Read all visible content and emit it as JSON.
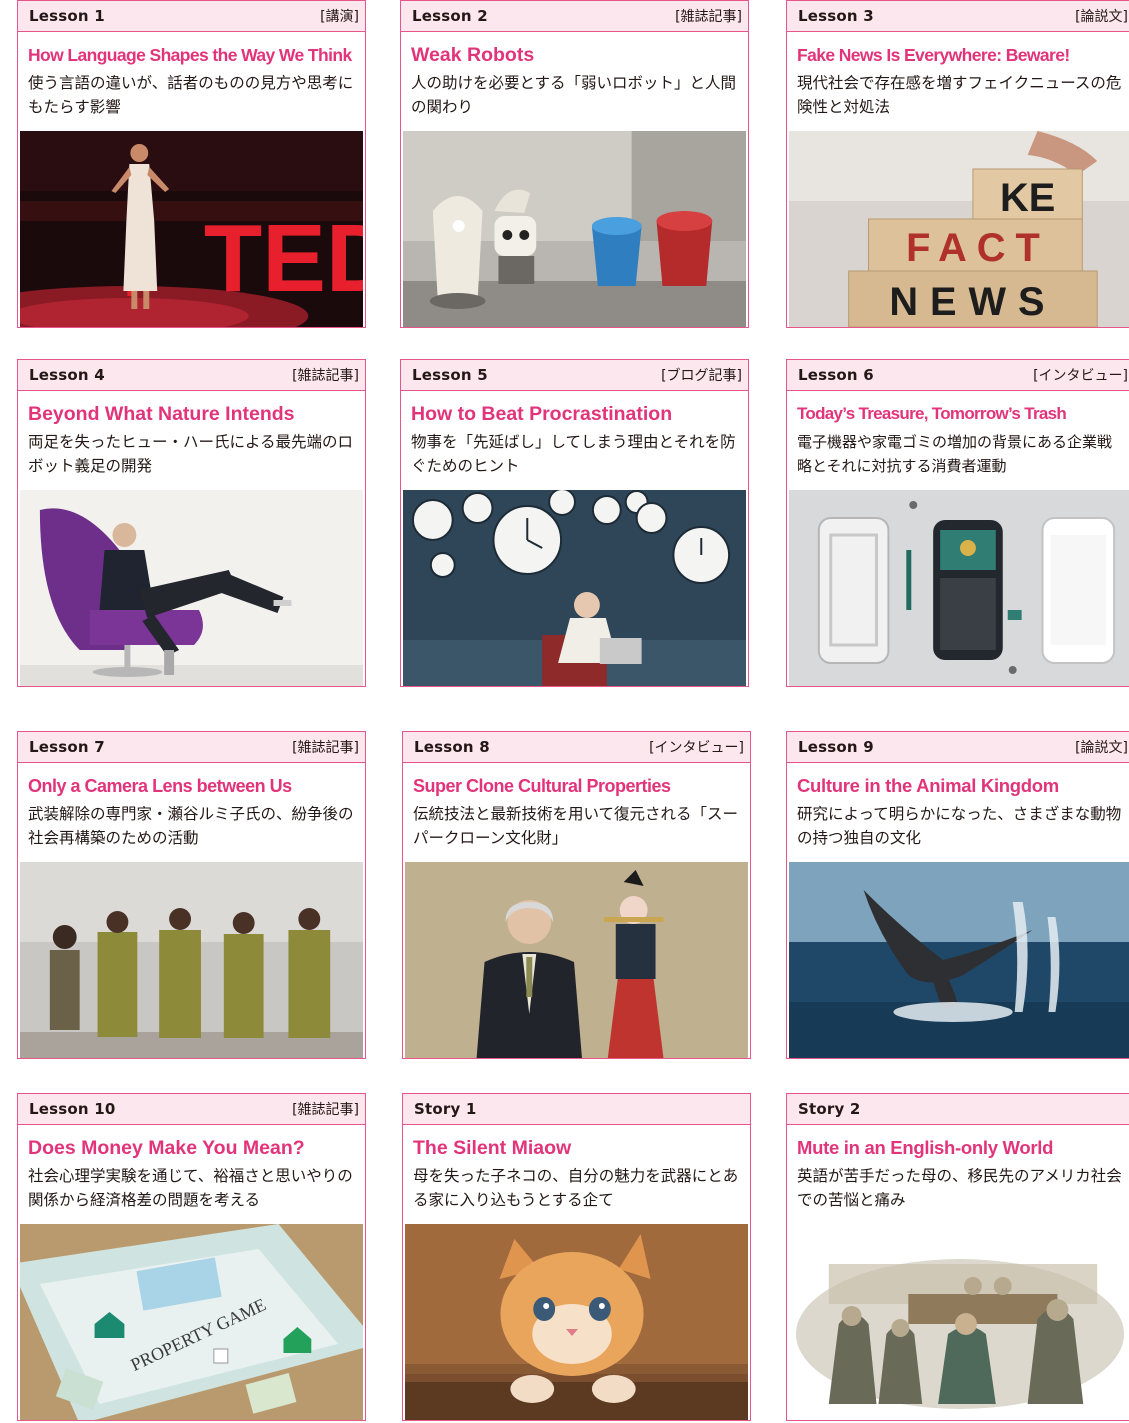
{
  "lessons": [
    {
      "label": "Lesson 1",
      "genre": "[講演]",
      "title": "How Language Shapes the Way We Think",
      "desc": "使う言語の違いが、話者のものの見方や思考にもたらす影響",
      "photo_icon": "ted-talk-stage-photo",
      "photo_text": "TED"
    },
    {
      "label": "Lesson 2",
      "genre": "[雑誌記事]",
      "title": "Weak Robots",
      "desc": "人の助けを必要とする「弱いロボット」と人間の関わり",
      "photo_icon": "weak-robots-photo"
    },
    {
      "label": "Lesson 3",
      "genre": "[論説文]",
      "title": "Fake News Is Everywhere: Beware!",
      "desc": "現代社会で存在感を増すフェイクニュースの危険性と対処法",
      "photo_icon": "fake-news-blocks-photo",
      "photo_text_top": "KE",
      "photo_text_mid": "FACT",
      "photo_text_bottom": "NEWS"
    },
    {
      "label": "Lesson 4",
      "genre": "[雑誌記事]",
      "title": "Beyond What Nature Intends",
      "desc": "両足を失ったヒュー・ハー氏による最先端のロボット義足の開発",
      "photo_icon": "prosthetic-legs-man-photo"
    },
    {
      "label": "Lesson 5",
      "genre": "[ブログ記事]",
      "title": "How to Beat Procrastination",
      "desc": "物事を「先延ばし」してしまう理由とそれを防ぐためのヒント",
      "photo_icon": "clocks-woman-laptop-photo"
    },
    {
      "label": "Lesson 6",
      "genre": "[インタビュー]",
      "title": "Today’s Treasure, Tomorrow’s Trash",
      "desc": "電子機器や家電ゴミの増加の背景にある企業戦略とそれに対抗する消費者運動",
      "photo_icon": "disassembled-smartphone-photo"
    },
    {
      "label": "Lesson 7",
      "genre": "[雑誌記事]",
      "title": "Only a Camera Lens between Us",
      "desc": "武装解除の専門家・瀬谷ルミ子氏の、紛争後の社会再構築のための活動",
      "photo_icon": "group-in-uniforms-photo"
    },
    {
      "label": "Lesson 8",
      "genre": "[インタビュー]",
      "title": "Super Clone Cultural Properties",
      "desc": "伝統技法と最新技術を用いて復元される「スーパークローン文化財」",
      "photo_icon": "man-and-flute-statue-photo"
    },
    {
      "label": "Lesson 9",
      "genre": "[論説文]",
      "title": "Culture in the Animal Kingdom",
      "desc": "研究によって明らかになった、さまざまな動物の持つ独自の文化",
      "photo_icon": "whale-tail-photo"
    },
    {
      "label": "Lesson 10",
      "genre": "[雑誌記事]",
      "title": "Does Money Make You Mean?",
      "desc": "社会心理学実験を通じて、裕福さと思いやりの関係から経済格差の問題を考える",
      "photo_icon": "property-board-game-photo",
      "photo_text": "PROPERTY GAME"
    },
    {
      "label": "Story 1",
      "genre": "",
      "title": "The Silent Miaow",
      "desc": "母を失った子ネコの、自分の魅力を武器にとある家に入り込もうとする企て",
      "photo_icon": "kitten-photo"
    },
    {
      "label": "Story 2",
      "genre": "",
      "title": "Mute in an English-only World",
      "desc": "英語が苦手だった母の、移民先のアメリカ社会での苦悩と痛み",
      "photo_icon": "immigrants-illustration"
    }
  ]
}
